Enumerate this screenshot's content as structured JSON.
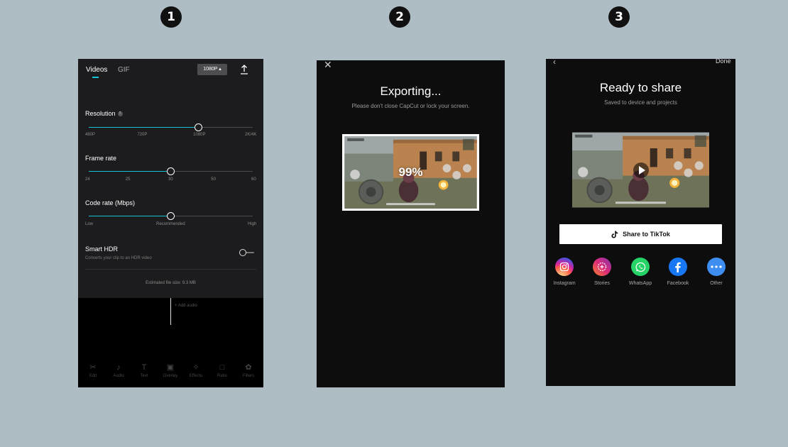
{
  "steps": [
    "1",
    "2",
    "3"
  ],
  "screen1": {
    "tabs": [
      "Videos",
      "GIF"
    ],
    "resolution_pill": "1080P ▴",
    "resolution": {
      "label": "Resolution",
      "help": "?",
      "ticks": [
        "480P",
        "720P",
        "1080P",
        "2K/4K"
      ],
      "value_fraction": 0.667
    },
    "frame_rate": {
      "label": "Frame rate",
      "ticks": [
        "24",
        "25",
        "30",
        "50",
        "60"
      ],
      "value_fraction": 0.5
    },
    "code_rate": {
      "label": "Code rate (Mbps)",
      "ticks": [
        "Low",
        "Recommended",
        "High"
      ],
      "value_fraction": 0.5
    },
    "smart_hdr": {
      "label": "Smart HDR",
      "sub": "Converts your clip to an HDR video",
      "enabled": false
    },
    "estimated_size": "Estimated file size: 9.3 MB",
    "add_audio": "+ Add audio",
    "nav": [
      {
        "icon": "scissors-icon",
        "glyph": "✂",
        "label": "Edit"
      },
      {
        "icon": "music-note-icon",
        "glyph": "♪",
        "label": "Audio"
      },
      {
        "icon": "text-icon",
        "glyph": "T",
        "label": "Text"
      },
      {
        "icon": "overlay-icon",
        "glyph": "▣",
        "label": "Overlay"
      },
      {
        "icon": "effects-icon",
        "glyph": "✧",
        "label": "Effects"
      },
      {
        "icon": "ratio-icon",
        "glyph": "□",
        "label": "Ratio"
      },
      {
        "icon": "filters-icon",
        "glyph": "✿",
        "label": "Filters"
      }
    ]
  },
  "screen2": {
    "close": "✕",
    "title": "Exporting...",
    "subtitle": "Please don't close CapCut or lock your screen.",
    "progress": "99%"
  },
  "screen3": {
    "back": "‹",
    "done": "Done",
    "title": "Ready to share",
    "subtitle": "Saved to device and projects",
    "tiktok_button": "Share to TikTok",
    "share": [
      {
        "label": "Instagram",
        "color": "#e1306c"
      },
      {
        "label": "Stories",
        "color": "#d62976"
      },
      {
        "label": "WhatsApp",
        "color": "#25d366"
      },
      {
        "label": "Facebook",
        "color": "#1877f2"
      },
      {
        "label": "Other",
        "color": "#3d8ef0"
      }
    ]
  },
  "colors": {
    "accent": "#19c3d6",
    "background": "#aebdc4"
  }
}
